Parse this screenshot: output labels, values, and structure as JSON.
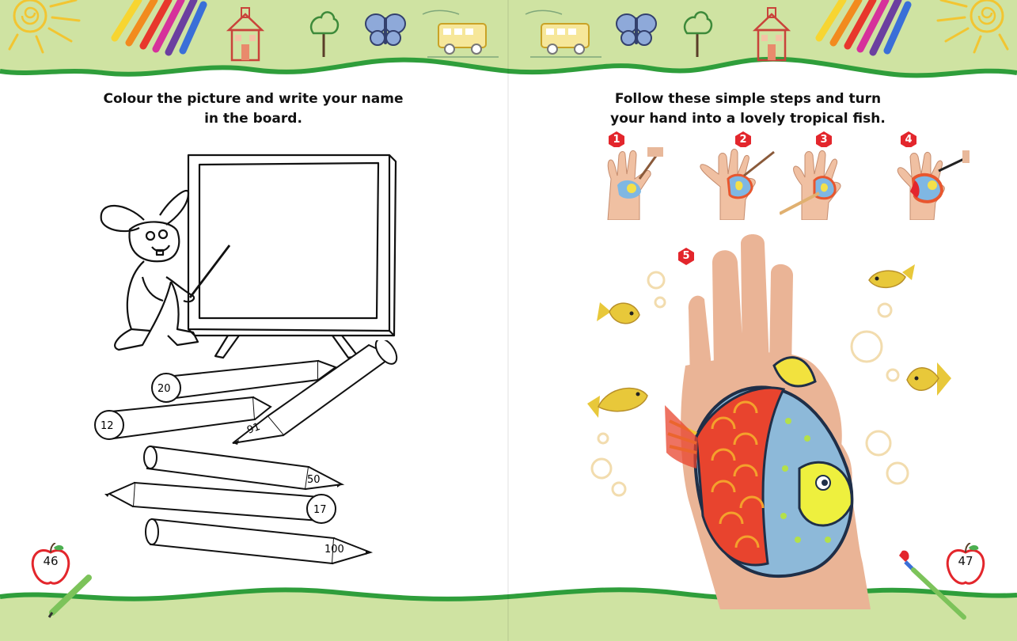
{
  "left_page": {
    "heading_line1": "Colour the picture and write your name",
    "heading_line2": "in the board.",
    "pencil_numbers": [
      "20",
      "12",
      "91",
      "50",
      "17",
      "100"
    ],
    "page_number": "46"
  },
  "right_page": {
    "heading_line1": "Follow these simple steps and turn",
    "heading_line2": "your hand into a lovely tropical fish.",
    "steps": [
      "1",
      "2",
      "3",
      "4",
      "5"
    ],
    "page_number": "47"
  },
  "colors": {
    "top_band": "#cfe3a2",
    "grass_line": "#2f9e3b",
    "step_badge": "#e3262c",
    "bubble": "#f2dcae",
    "fish_yellow": "#e8c83a"
  },
  "icons": [
    "sun-icon",
    "crayons-icon",
    "schoolhouse-icon",
    "tree-icon",
    "butterfly-icon",
    "school-bus-icon",
    "apple-icon",
    "paintbrush-icon",
    "pencil-icon"
  ]
}
